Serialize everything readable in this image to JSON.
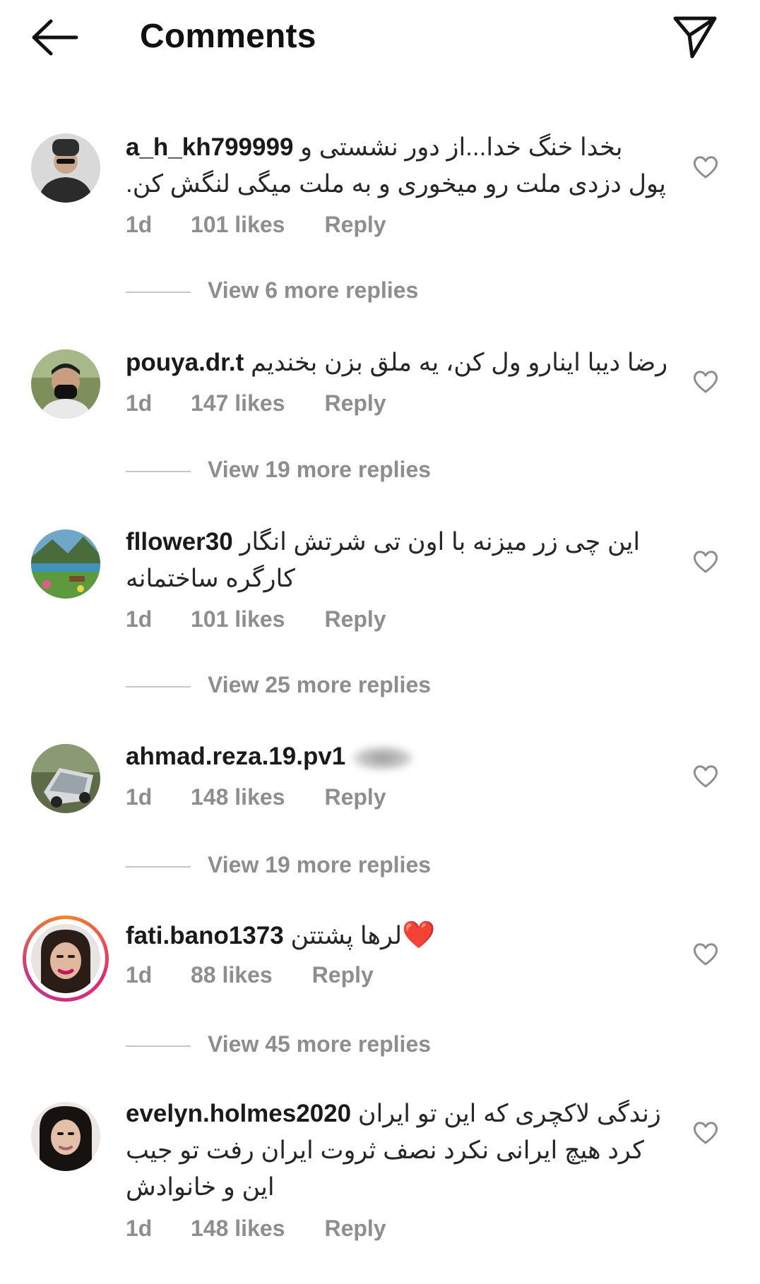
{
  "header": {
    "title": "Comments",
    "back_icon": "arrow-left-icon",
    "share_icon": "paper-plane-icon"
  },
  "comments": [
    {
      "username": "a_h_kh799999",
      "text_line1": "بخدا خنگ خدا...از دور نشستی و",
      "text_line2": "پول دزدی ملت رو میخوری و به ملت میگی لنگش کن.",
      "time": "1d",
      "likes": "101 likes",
      "reply": "Reply",
      "view_replies": "View 6 more replies"
    },
    {
      "username": "pouya.dr.t",
      "text_line1": "رضا دیبا اینارو ول کن، یه ملق بزن بخندیم",
      "time": "1d",
      "likes": "147 likes",
      "reply": "Reply",
      "view_replies": "View 19 more replies"
    },
    {
      "username": "fllower30",
      "text_line1": "این چی زر میزنه با اون تی شرتش انگار",
      "text_line2": "کارگره ساختمانه",
      "time": "1d",
      "likes": "101 likes",
      "reply": "Reply",
      "view_replies": "View 25 more replies"
    },
    {
      "username": "ahmad.reza.19.pv1",
      "time": "1d",
      "likes": "148 likes",
      "reply": "Reply",
      "view_replies": "View 19 more replies"
    },
    {
      "username": "fati.bano1373",
      "text_line1": "لرها پشتتن",
      "emoji": "❤️",
      "time": "1d",
      "likes": "88 likes",
      "reply": "Reply",
      "view_replies": "View 45 more replies"
    },
    {
      "username": "evelyn.holmes2020",
      "text_line1": "زندگی لاکچری که این تو ایران",
      "text_line2": "کرد هیچ ایرانی نکرد نصف ثروت ایران رفت تو جیب",
      "text_line3": "این و خانوادش",
      "time": "1d",
      "likes": "148 likes",
      "reply": "Reply"
    }
  ],
  "icons": {
    "like": "heart-outline-icon"
  },
  "colors": {
    "text": "#262626",
    "meta": "#8e8e8e",
    "story_ring": "#dd2a7b",
    "emoji_heart": "#e0203a"
  }
}
